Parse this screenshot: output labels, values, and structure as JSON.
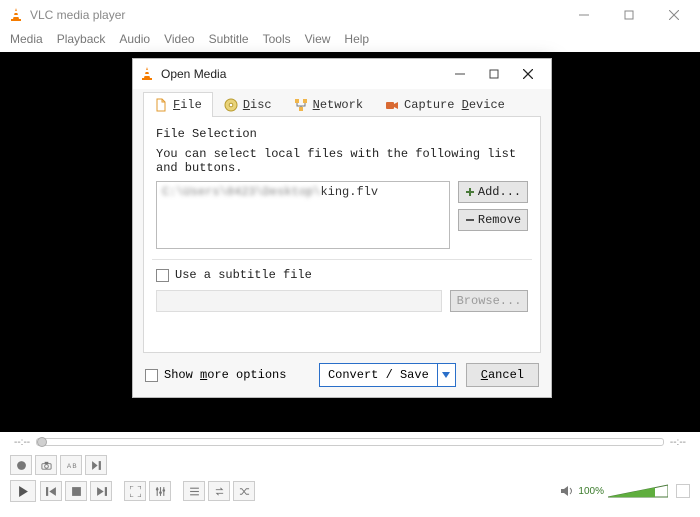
{
  "window": {
    "title": "VLC media player"
  },
  "menu": [
    "Media",
    "Playback",
    "Audio",
    "Video",
    "Subtitle",
    "Tools",
    "View",
    "Help"
  ],
  "seek": {
    "left_time": "--:--",
    "right_time": "--:--"
  },
  "volume": {
    "percent": "100%"
  },
  "dialog": {
    "title": "Open Media",
    "tabs": {
      "file": {
        "key": "F",
        "rest": "ile"
      },
      "disc": {
        "key": "D",
        "rest": "isc"
      },
      "network": {
        "key": "N",
        "rest": "etwork"
      },
      "capture": {
        "label": "Capture ",
        "key": "D",
        "rest": "evice"
      }
    },
    "file_selection_label": "File Selection",
    "hint": "You can select local files with the following list and buttons.",
    "file_entry": {
      "blurred": "C:\\Users\\0423\\Desktop\\",
      "clear": "king.flv"
    },
    "add_btn": "Add...",
    "remove_btn": "Remove",
    "subtitle_chk": "Use a subtitle file",
    "browse_btn": "Browse...",
    "more_opts_pre": "Show ",
    "more_opts_key": "m",
    "more_opts_post": "ore options",
    "convert_btn": "Convert / Save",
    "cancel_pre": "",
    "cancel_key": "C",
    "cancel_post": "ancel"
  }
}
